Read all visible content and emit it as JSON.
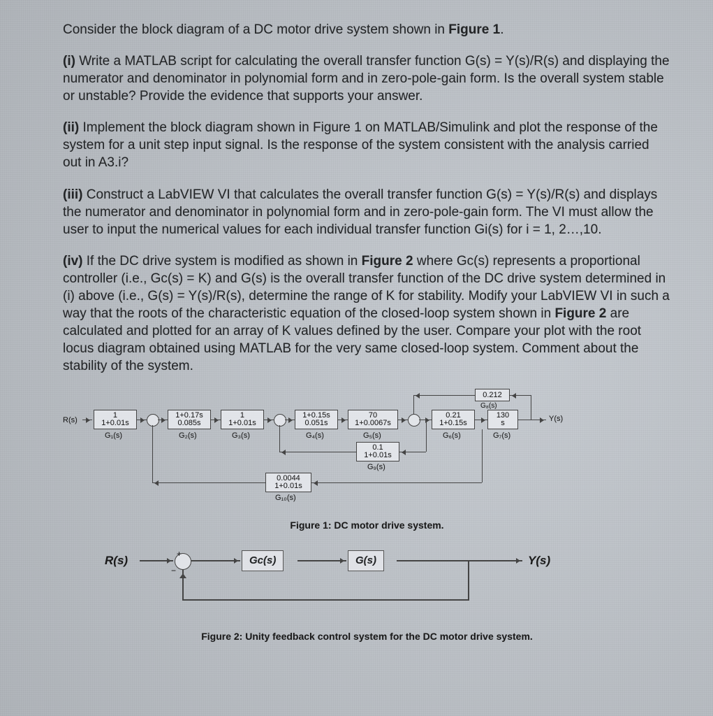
{
  "intro": "Consider the block diagram of a DC motor drive system shown in ",
  "intro_fig": "Figure 1",
  "intro_end": ".",
  "p1_tag": "(i) ",
  "p1": "Write a MATLAB script for calculating the overall transfer function G(s) = Y(s)/R(s) and displaying the numerator and denominator in polynomial form and in zero-pole-gain form. Is the overall system stable or unstable? Provide the evidence that supports your answer.",
  "p2_tag": "(ii) ",
  "p2": "Implement the block diagram shown in Figure 1 on MATLAB/Simulink and plot the response of the system for a unit step input signal. Is the response of the system consistent with the analysis carried out in A3.i?",
  "p3_tag": "(iii) ",
  "p3": "Construct a LabVIEW VI that calculates the overall transfer function G(s) = Y(s)/R(s) and displays the numerator and denominator in polynomial form and in zero-pole-gain form. The VI must allow the user to input the numerical values for each individual transfer function Gi(s) for i = 1, 2…,10.",
  "p4_tag": "(iv) ",
  "p4a": "If the DC drive system is modified as shown in ",
  "p4_fig": "Figure 2",
  "p4b": " where Gc(s) represents a proportional controller (i.e., Gc(s) = K) and G(s) is the overall transfer function of the DC drive system determined in (i) above (i.e., G(s) = Y(s)/R(s), determine the range of K for stability. Modify your LabVIEW VI in such a way that the roots of the characteristic equation of the closed-loop system shown in ",
  "p4_fig2": "Figure 2",
  "p4c": " are calculated and plotted for an array of K values defined by the user. Compare your plot with the root locus diagram obtained using MATLAB for the very same closed-loop system. Comment about the stability of the system.",
  "fig1": {
    "caption": "Figure 1: DC motor drive system.",
    "rs": "R(s)",
    "ys": "Y(s)",
    "g1": {
      "tf": "1\n1+0.01s",
      "lbl": "G₁(s)"
    },
    "g2": {
      "tf": "1+0.17s\n0.085s",
      "lbl": "G₂(s)"
    },
    "g3": {
      "tf": "1\n1+0.01s",
      "lbl": "G₃(s)"
    },
    "g4": {
      "tf": "1+0.15s\n0.051s",
      "lbl": "G₄(s)"
    },
    "g5": {
      "tf": "70\n1+0.0067s",
      "lbl": "G₅(s)"
    },
    "g6": {
      "tf": "0.21\n1+0.15s",
      "lbl": "G₆(s)"
    },
    "g7": {
      "tf": "130\ns",
      "lbl": "G₇(s)"
    },
    "g8": {
      "tf": "0.212",
      "lbl": "G₈(s)"
    },
    "g9": {
      "tf": "0.1\n1+0.01s",
      "lbl": "G₉(s)"
    },
    "g10": {
      "tf": "0.0044\n1+0.01s",
      "lbl": "G₁₀(s)"
    }
  },
  "fig2": {
    "caption": "Figure 2: Unity feedback control system for the DC motor drive system.",
    "rs": "R(s)",
    "ys": "Y(s)",
    "gc": "Gc(s)",
    "g": "G(s)"
  }
}
